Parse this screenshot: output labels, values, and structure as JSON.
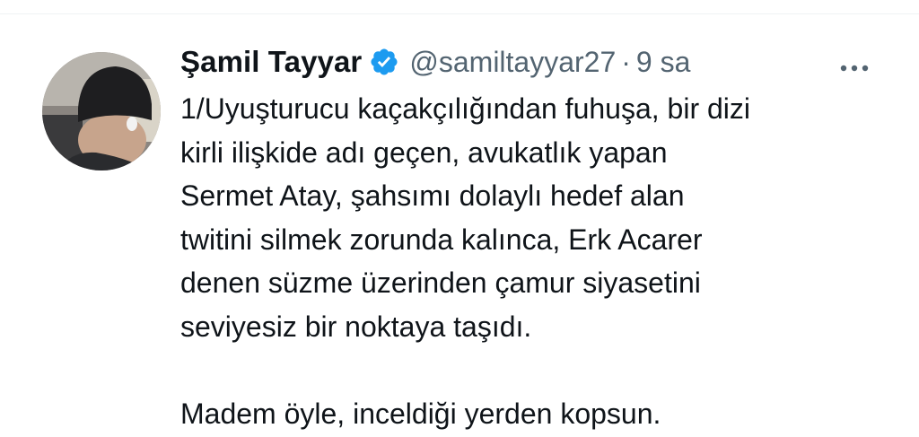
{
  "tweet": {
    "author_name": "Şamil Tayyar",
    "handle": "@samiltayyar27",
    "separator": "·",
    "time": "9 sa",
    "verified": true,
    "accent_color": "#1d9bf0",
    "text_lines": [
      "1/Uyuşturucu kaçakçılığından fuhuşa, bir dizi",
      "kirli ilişkide adı geçen, avukatlık yapan",
      "Sermet Atay, şahsımı dolaylı hedef alan",
      "twitini silmek zorunda kalınca, Erk Acarer",
      "denen süzme üzerinden çamur siyasetini",
      "seviyesiz bir noktaya taşıdı.",
      "",
      "Madem öyle, inceldiği yerden kopsun."
    ]
  },
  "icons": {
    "verified": "verified-badge-icon",
    "more": "more-horizontal-icon"
  }
}
